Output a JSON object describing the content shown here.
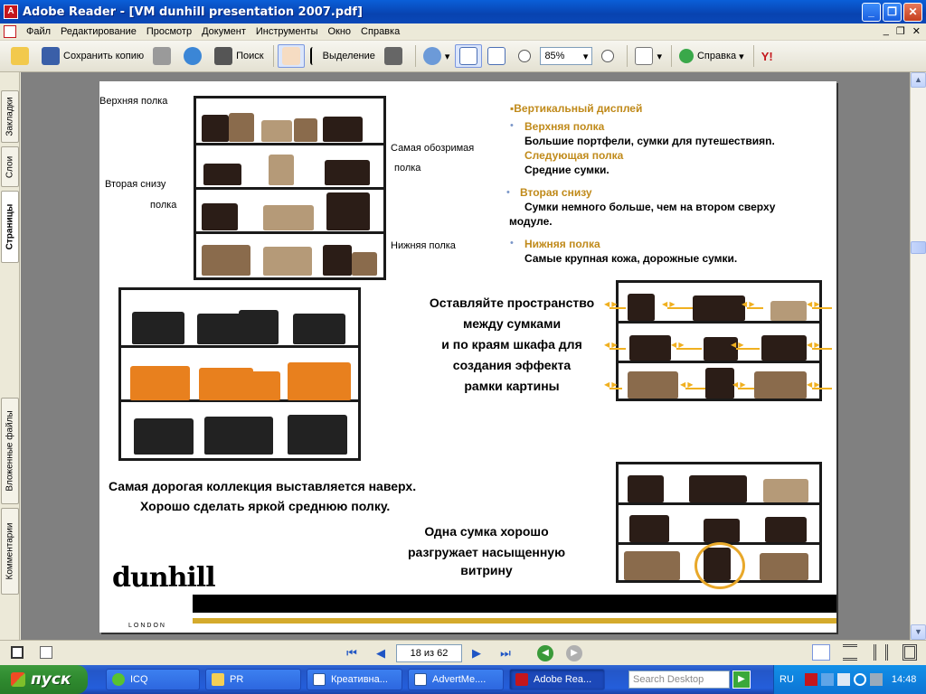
{
  "window": {
    "title": "Adobe Reader - [VM dunhill presentation 2007.pdf]",
    "minimize": "_",
    "maximize": "❐",
    "close": "✕"
  },
  "menu": {
    "items": [
      "Файл",
      "Редактирование",
      "Просмотр",
      "Документ",
      "Инструменты",
      "Окно",
      "Справка"
    ],
    "right": [
      "_",
      "❐",
      "✕"
    ]
  },
  "toolbar": {
    "save_copy": "Сохранить копию",
    "search": "Поиск",
    "select": "Выделение",
    "zoom": "85%",
    "help": "Справка",
    "yahoo": "Y!"
  },
  "left_tabs": [
    "Закладки",
    "Слои",
    "Страницы",
    "Вложенные файлы",
    "Комментарии"
  ],
  "page": {
    "shelf_labels": {
      "top": "Верхняя полка",
      "second_from_bottom_1": "Вторая снизу",
      "second_from_bottom_2": "полка",
      "most_visible_1": "Самая обозримая",
      "most_visible_2": "полка",
      "bottom": "Нижняя полка"
    },
    "heading": "▪Вертикальный дисплей",
    "bullets": [
      {
        "title": "Верхняя полка",
        "text": "Большие портфели, сумки для путешествияn."
      },
      {
        "title": "Следующая полка",
        "text": "Средние сумки."
      },
      {
        "title": "Вторая снизу",
        "text": "Сумки немного больше, чем на втором сверху",
        "text2": "модуле."
      },
      {
        "title": "Нижняя полка",
        "text": "Самые крупная кожа, дорожные сумки."
      }
    ],
    "space_text": [
      "Оставляйте пространство",
      "между сумками",
      "и по краям шкафа для",
      "создания эффекта",
      "рамки картины"
    ],
    "collection_text": [
      "Самая дорогая коллекция выставляется наверх.",
      "Хорошо сделать яркой среднюю полку."
    ],
    "one_bag_text": [
      "Одна сумка хорошо",
      "разгружает насыщенную",
      "витрину"
    ],
    "logo": "dunhill",
    "logo_sub": "LONDON"
  },
  "statusbar": {
    "page_field": "18 из 62"
  },
  "taskbar": {
    "start": "пуск",
    "tasks": [
      "ICQ",
      "PR",
      "Креативна...",
      "AdvertMe....",
      "Adobe Rea..."
    ],
    "search_placeholder": "Search Desktop",
    "lang": "RU",
    "clock": "14:48"
  }
}
